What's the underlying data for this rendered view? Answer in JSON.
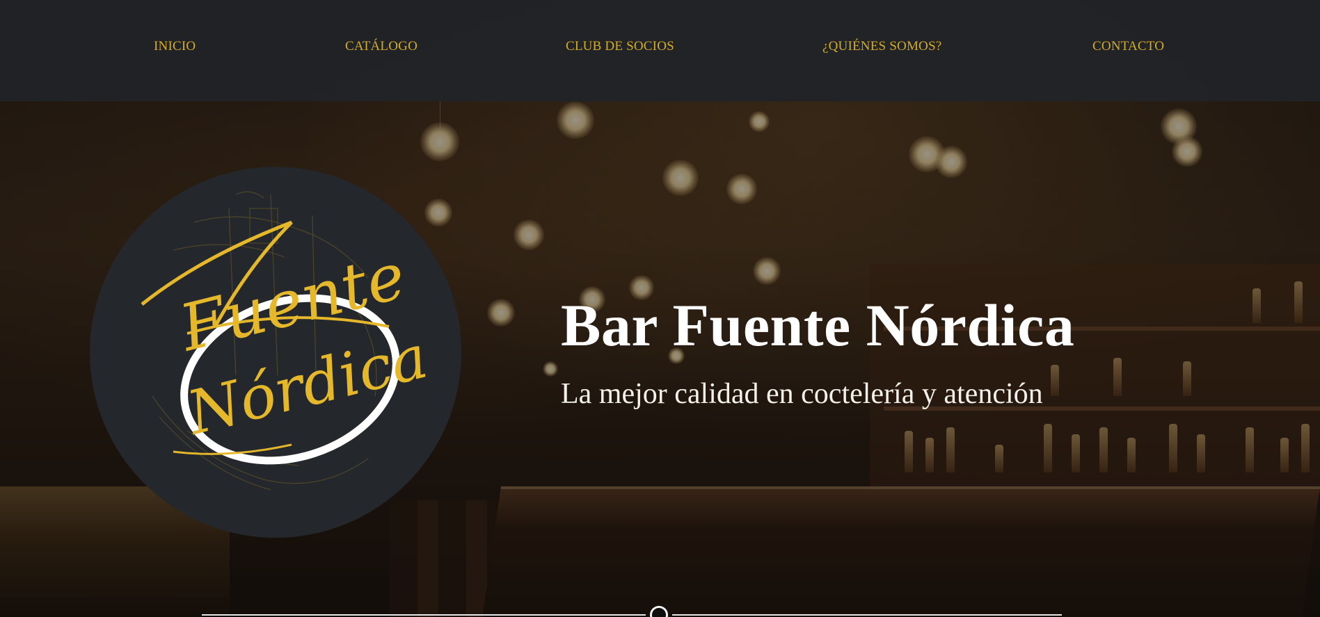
{
  "nav": {
    "items": [
      {
        "label": "INICIO"
      },
      {
        "label": "CATÁLOGO"
      },
      {
        "label": "CLUB DE SOCIOS"
      },
      {
        "label": "¿QUIÉNES SOMOS?"
      },
      {
        "label": "CONTACTO"
      }
    ]
  },
  "logo": {
    "text_line1": "Fuente",
    "text_line2": "Nórdica"
  },
  "hero": {
    "title": "Bar Fuente Nórdica",
    "subtitle": "La mejor calidad en coctelería y atención"
  },
  "colors": {
    "accent_gold": "#d4ad27",
    "header_bg": "#212428",
    "logo_bg": "#24272b",
    "text_white": "#ffffff"
  },
  "icons": {
    "scroll_indicator": "scroll-down-icon"
  }
}
